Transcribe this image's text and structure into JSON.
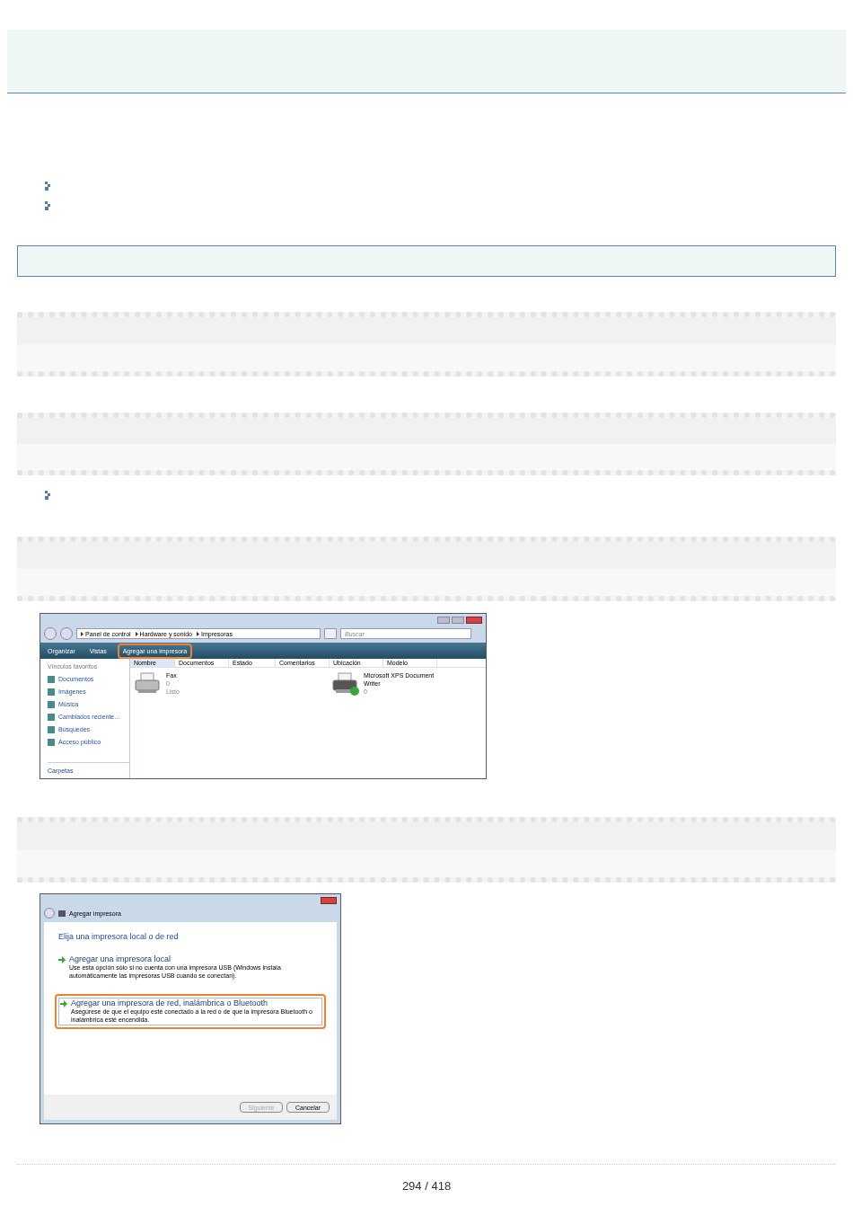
{
  "explorer": {
    "breadcrumb": [
      "Panel de control",
      "Hardware y sonido",
      "Impresoras"
    ],
    "search": {
      "placeholder": "Buscar"
    },
    "toolbar": [
      {
        "label": "Organizar",
        "highlighted": false
      },
      {
        "label": "Vistas",
        "highlighted": false
      },
      {
        "label": "Agregar una impresora",
        "highlighted": true
      }
    ],
    "sidebar": {
      "heading": "Vínculos favoritos",
      "items": [
        "Documentos",
        "Imágenes",
        "Música",
        "Cambiados reciente...",
        "Búsquedes",
        "Acceso público"
      ],
      "folders": "Carpetas"
    },
    "columns": [
      "Nombre",
      "Documentos",
      "Estado",
      "Comentarios",
      "Ubicación",
      "Modelo"
    ],
    "printers": [
      {
        "name": "Fax",
        "documents": "0",
        "status": "Listo",
        "default": false
      },
      {
        "name": "Microsoft XPS Document Writer",
        "documents": "0",
        "default": true
      }
    ]
  },
  "wizard": {
    "title": "Agregar impresora",
    "heading": "Elija una impresora local o de red",
    "options": [
      {
        "title": "Agregar una impresora local",
        "description": "Use esta opción sólo si no cuenta con una impresora USB (Windows instala automáticamente las impresoras USB cuando se conectan).",
        "highlighted": false
      },
      {
        "title": "Agregar una impresora de red, inalámbrica o Bluetooth",
        "description": "Asegúrese de que el equipo esté conectado a la red o de que la impresora Bluetooth o inalámbrica esté encendida.",
        "highlighted": true
      }
    ],
    "buttons": [
      {
        "label": "Siguiente",
        "disabled": true
      },
      {
        "label": "Cancelar",
        "disabled": false
      }
    ]
  },
  "page_number": "294 / 418"
}
